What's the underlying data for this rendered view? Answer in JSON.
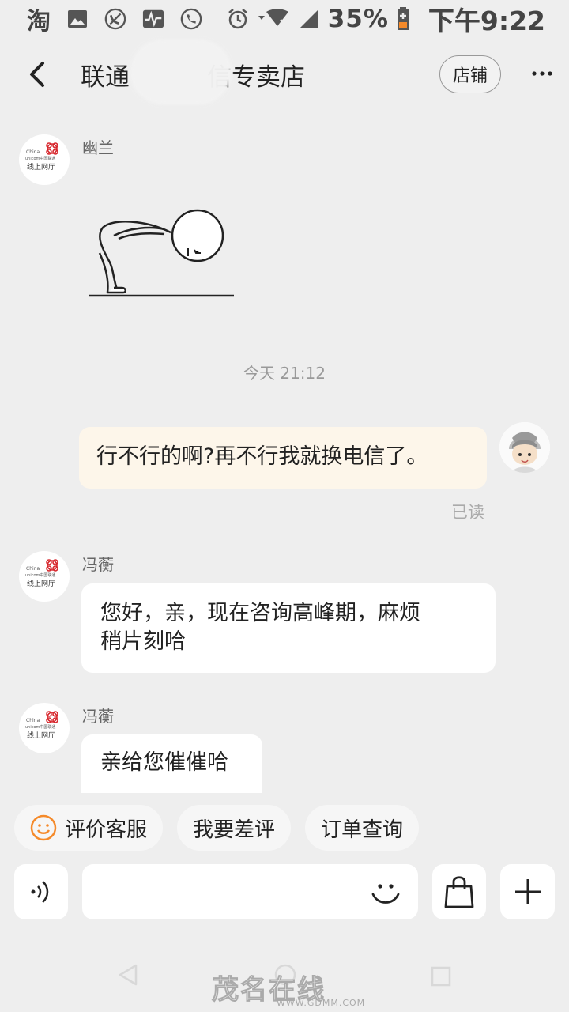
{
  "status_bar": {
    "taobao_glyph": "淘",
    "battery": "35%",
    "time": "下午9:22"
  },
  "header": {
    "title_left": "联通",
    "title_right": "信专卖店",
    "shop_button": "店铺"
  },
  "logo": {
    "brand": "China unicom中国联通",
    "subtitle": "线上网厅"
  },
  "messages": [
    {
      "sender": "幽兰",
      "type": "sticker",
      "sticker": "bowing-stick-figure"
    },
    {
      "type": "time",
      "text": "今天 21:12"
    },
    {
      "type": "mine",
      "text": "行不行的啊?再不行我就换电信了。",
      "status": "已读"
    },
    {
      "sender": "冯蘅",
      "type": "text",
      "line1": "您好，亲，现在咨询高峰期，麻烦",
      "line2": "稍片刻哈"
    },
    {
      "sender": "冯蘅",
      "type": "text",
      "text": "亲给您催催哈"
    }
  ],
  "chips": [
    "评价客服",
    "我要差评",
    "订单查询"
  ],
  "input": {
    "value": "",
    "placeholder": ""
  },
  "nav": {
    "watermark": "茂名在线",
    "watermark_url": "WWW.GDMM.COM"
  },
  "colors": {
    "background": "#eeeeee",
    "my_bubble": "#fdf6ea",
    "chip_icon": "#f58a2a",
    "unicom_red": "#d7262c"
  }
}
